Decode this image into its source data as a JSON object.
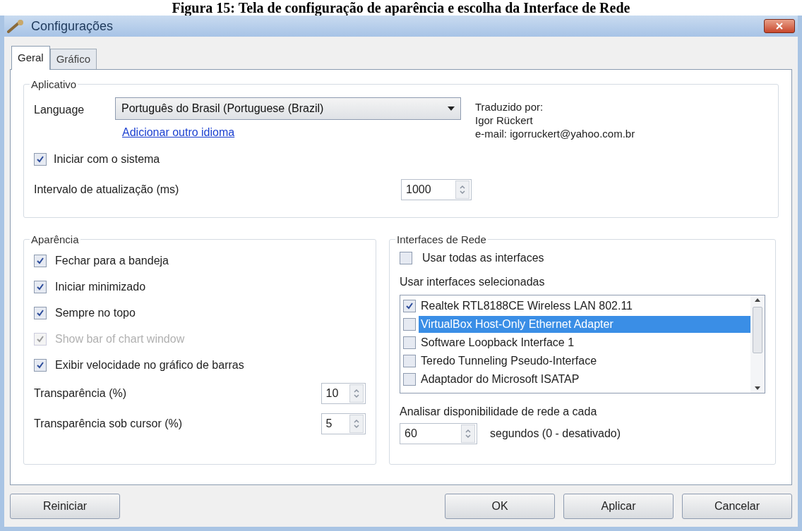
{
  "caption": "Figura 15: Tela de configuração de aparência e escolha da Interface de Rede",
  "window": {
    "title": "Configurações"
  },
  "tabs": [
    {
      "label": "Geral",
      "selected": true
    },
    {
      "label": "Gráfico",
      "selected": false
    }
  ],
  "aplicativo": {
    "title": "Aplicativo",
    "language_label": "Language",
    "language_value": "Português do Brasil (Portuguese (Brazil)",
    "add_language_link": "Adicionar outro idioma",
    "translator": [
      "Traduzido por:",
      "Igor Rückert",
      "e-mail: igorruckert@yahoo.com.br"
    ],
    "start_with_system": {
      "label": "Iniciar com o sistema",
      "checked": true
    },
    "interval": {
      "label": "Intervalo de atualização (ms)",
      "value": "1000"
    }
  },
  "aparencia": {
    "title": "Aparência",
    "options": [
      {
        "label": "Fechar para a bandeja",
        "checked": true,
        "disabled": false
      },
      {
        "label": "Iniciar minimizado",
        "checked": true,
        "disabled": false
      },
      {
        "label": "Sempre no topo",
        "checked": true,
        "disabled": false
      },
      {
        "label": "Show bar of chart window",
        "checked": true,
        "disabled": true
      },
      {
        "label": "Exibir velocidade no gráfico de barras",
        "checked": true,
        "disabled": false
      }
    ],
    "spinners": [
      {
        "label": "Transparência (%)",
        "value": "10"
      },
      {
        "label": "Transparência sob cursor (%)",
        "value": "5"
      }
    ]
  },
  "interfaces": {
    "title": "Interfaces de Rede",
    "use_all": {
      "label": "Usar todas as interfaces",
      "checked": false
    },
    "list_label": "Usar interfaces selecionadas",
    "list": [
      {
        "label": "Realtek RTL8188CE Wireless LAN 802.11",
        "checked": true,
        "selected": false
      },
      {
        "label": "VirtualBox Host-Only Ethernet Adapter",
        "checked": false,
        "selected": true
      },
      {
        "label": "Software Loopback Interface 1",
        "checked": false,
        "selected": false
      },
      {
        "label": "Teredo Tunneling Pseudo-Interface",
        "checked": false,
        "selected": false
      },
      {
        "label": "Adaptador do Microsoft ISATAP",
        "checked": false,
        "selected": false
      }
    ],
    "check_label": "Analisar disponibilidade de rede a cada",
    "check_value": "60",
    "check_unit": "segundos (0 - desativado)"
  },
  "footer": {
    "left": [
      "Reiniciar"
    ],
    "right": [
      "OK",
      "Aplicar",
      "Cancelar"
    ]
  }
}
